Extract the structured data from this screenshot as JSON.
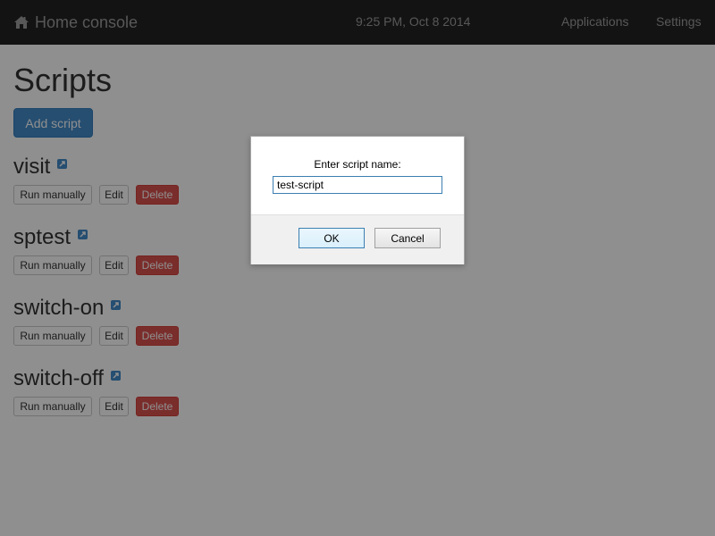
{
  "navbar": {
    "brand_icon": "home-icon",
    "brand_label": "Home console",
    "clock": "9:25 PM, Oct 8 2014",
    "links": [
      {
        "label": "Applications"
      },
      {
        "label": "Settings"
      }
    ]
  },
  "main": {
    "title": "Scripts",
    "add_button": "Add script",
    "scripts": [
      {
        "name": "visit",
        "icon": "external-link-icon",
        "run": "Run manually",
        "edit": "Edit",
        "delete": "Delete"
      },
      {
        "name": "sptest",
        "icon": "external-link-icon",
        "run": "Run manually",
        "edit": "Edit",
        "delete": "Delete"
      },
      {
        "name": "switch-on",
        "icon": "external-link-icon",
        "run": "Run manually",
        "edit": "Edit",
        "delete": "Delete"
      },
      {
        "name": "switch-off",
        "icon": "external-link-icon",
        "run": "Run manually",
        "edit": "Edit",
        "delete": "Delete"
      }
    ]
  },
  "dialog": {
    "prompt": "Enter script name:",
    "input_value": "test-script",
    "ok_label": "OK",
    "cancel_label": "Cancel"
  },
  "colors": {
    "navbar_bg": "#222222",
    "primary": "#428bca",
    "danger": "#d9534f",
    "overlay": "rgba(0,0,0,0.44)"
  }
}
